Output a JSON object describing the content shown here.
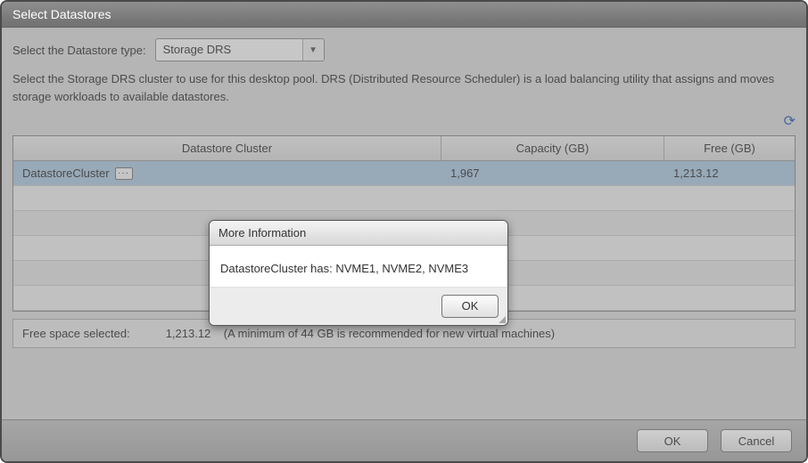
{
  "window": {
    "title": "Select Datastores"
  },
  "type_row": {
    "label": "Select the Datastore type:",
    "selected": "Storage DRS"
  },
  "description": "Select the Storage DRS cluster to use for this desktop pool. DRS (Distributed Resource Scheduler) is a load balancing utility that assigns and moves storage workloads to available datastores.",
  "columns": {
    "ds": "Datastore Cluster",
    "cap": "Capacity (GB)",
    "free": "Free (GB)"
  },
  "rows": [
    {
      "name": "DatastoreCluster",
      "capacity": "1,967",
      "free": "1,213.12",
      "selected": true
    }
  ],
  "footer": {
    "label": "Free space selected:",
    "value": "1,213.12",
    "note": "(A minimum of 44 GB is recommended for new virtual machines)"
  },
  "buttons": {
    "ok": "OK",
    "cancel": "Cancel"
  },
  "modal": {
    "title": "More Information",
    "body": "DatastoreCluster has: NVME1, NVME2, NVME3",
    "ok": "OK"
  },
  "icons": {
    "more": "···",
    "refresh": "⟳",
    "dropdown": "▼"
  }
}
